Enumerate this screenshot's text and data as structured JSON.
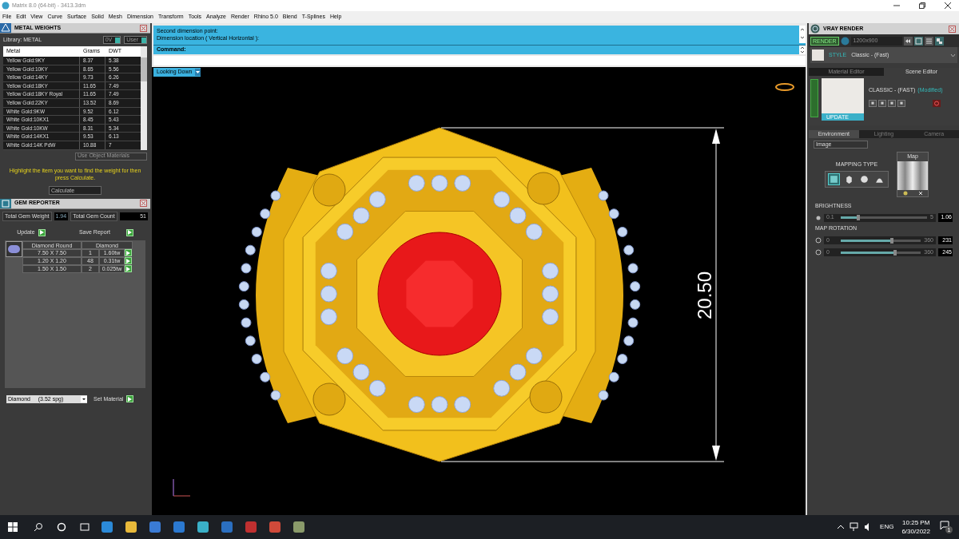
{
  "window": {
    "title": "Matrix 8.0 (64-bit) - 3413.3dm"
  },
  "menu": [
    "File",
    "Edit",
    "View",
    "Curve",
    "Surface",
    "Solid",
    "Mesh",
    "Dimension",
    "Transform",
    "Tools",
    "Analyze",
    "Render",
    "Rhino 5.0",
    "Blend",
    "T-Splines",
    "Help"
  ],
  "metal_weights": {
    "title": "METAL WEIGHTS",
    "library": "Library: METAL",
    "toggles": [
      {
        "label": "0V",
        "on": true
      },
      {
        "label": "User",
        "on": true
      }
    ],
    "columns": [
      "Metal",
      "Grams",
      "DWT"
    ],
    "rows": [
      {
        "metal": "Yellow Gold:9KY",
        "grams": "8.37",
        "dwt": "5.38"
      },
      {
        "metal": "Yellow Gold:10KY",
        "grams": "8.65",
        "dwt": "5.56"
      },
      {
        "metal": "Yellow Gold:14KY",
        "grams": "9.73",
        "dwt": "6.26"
      },
      {
        "metal": "Yellow Gold:18KY",
        "grams": "11.65",
        "dwt": "7.49"
      },
      {
        "metal": "Yellow Gold:18KY Royal",
        "grams": "11.65",
        "dwt": "7.49"
      },
      {
        "metal": "Yellow Gold:22KY",
        "grams": "13.52",
        "dwt": "8.69"
      },
      {
        "metal": "White Gold:9KW",
        "grams": "9.52",
        "dwt": "6.12"
      },
      {
        "metal": "White Gold:10KX1",
        "grams": "8.45",
        "dwt": "5.43"
      },
      {
        "metal": "White Gold:10KW",
        "grams": "8.31",
        "dwt": "5.34"
      },
      {
        "metal": "White Gold:14KX1",
        "grams": "9.53",
        "dwt": "6.13"
      },
      {
        "metal": "White Gold:14K PdW",
        "grams": "10.88",
        "dwt": "7"
      }
    ],
    "use_object_materials": "Use Object Materials",
    "hint": "Highlight the item you want to find the weight for then press Calculate.",
    "calculate": "Calculate"
  },
  "gem_reporter": {
    "title": "GEM REPORTER",
    "weight_label": "Total Gem Weight",
    "weight": "1.94",
    "count_label": "Total Gem Count",
    "count": "51",
    "update": "Update",
    "save": "Save Report",
    "columns": [
      "Diamond Round",
      "Diamond"
    ],
    "rows": [
      {
        "size": "7.50 X 7.50",
        "count": "1",
        "weight": "1.60tw"
      },
      {
        "size": "1.20 X 1.20",
        "count": "48",
        "weight": "0.31tw"
      },
      {
        "size": "1.50 X 1.50",
        "count": "2",
        "weight": "0.025tw"
      }
    ],
    "material": "Diamond     (3.52 spg)",
    "set_material": "Set Material"
  },
  "command": {
    "lines": [
      "Second dimension point:",
      "Dimension location ( Vertical  Horizontal ):"
    ],
    "prompt": "Command:"
  },
  "viewport": {
    "view": "Looking Down",
    "dimension": "20.50"
  },
  "vray": {
    "title": "VRAY RENDER",
    "render": "RENDER",
    "resolution": "1200x900",
    "style_label": "STYLE",
    "style": "Classic - (Fast)",
    "tabs": [
      {
        "label": "Material Editor",
        "selected": false
      },
      {
        "label": "Scene Editor",
        "selected": true
      }
    ],
    "preset": "CLASSIC - (FAST)",
    "modified": "(Modified)",
    "update": "UPDATE",
    "env_tabs": [
      {
        "label": "Environment",
        "selected": true
      },
      {
        "label": "Lighting",
        "selected": false
      },
      {
        "label": "Camera",
        "selected": false
      }
    ],
    "source": "Image",
    "mapping_label": "MAPPING TYPE",
    "mapping": [
      {
        "kind": "plane",
        "selected": true
      },
      {
        "kind": "cube",
        "selected": false
      },
      {
        "kind": "sphere",
        "selected": false
      },
      {
        "kind": "dome",
        "selected": false
      }
    ],
    "map_label": "Map",
    "brightness": {
      "label": "BRIGHTNESS",
      "min": "0.1",
      "max": "5",
      "value": "1.06",
      "level": 0.2
    },
    "rotation_label": "MAP ROTATION",
    "rotations": [
      {
        "min": "0",
        "max": "360",
        "value": "231",
        "level": 0.64
      },
      {
        "min": "0",
        "max": "360",
        "value": "245",
        "level": 0.68
      }
    ]
  },
  "taskbar": {
    "language": "ENG",
    "time": "10:25 PM",
    "date": "6/30/2022",
    "notifications": "1"
  }
}
